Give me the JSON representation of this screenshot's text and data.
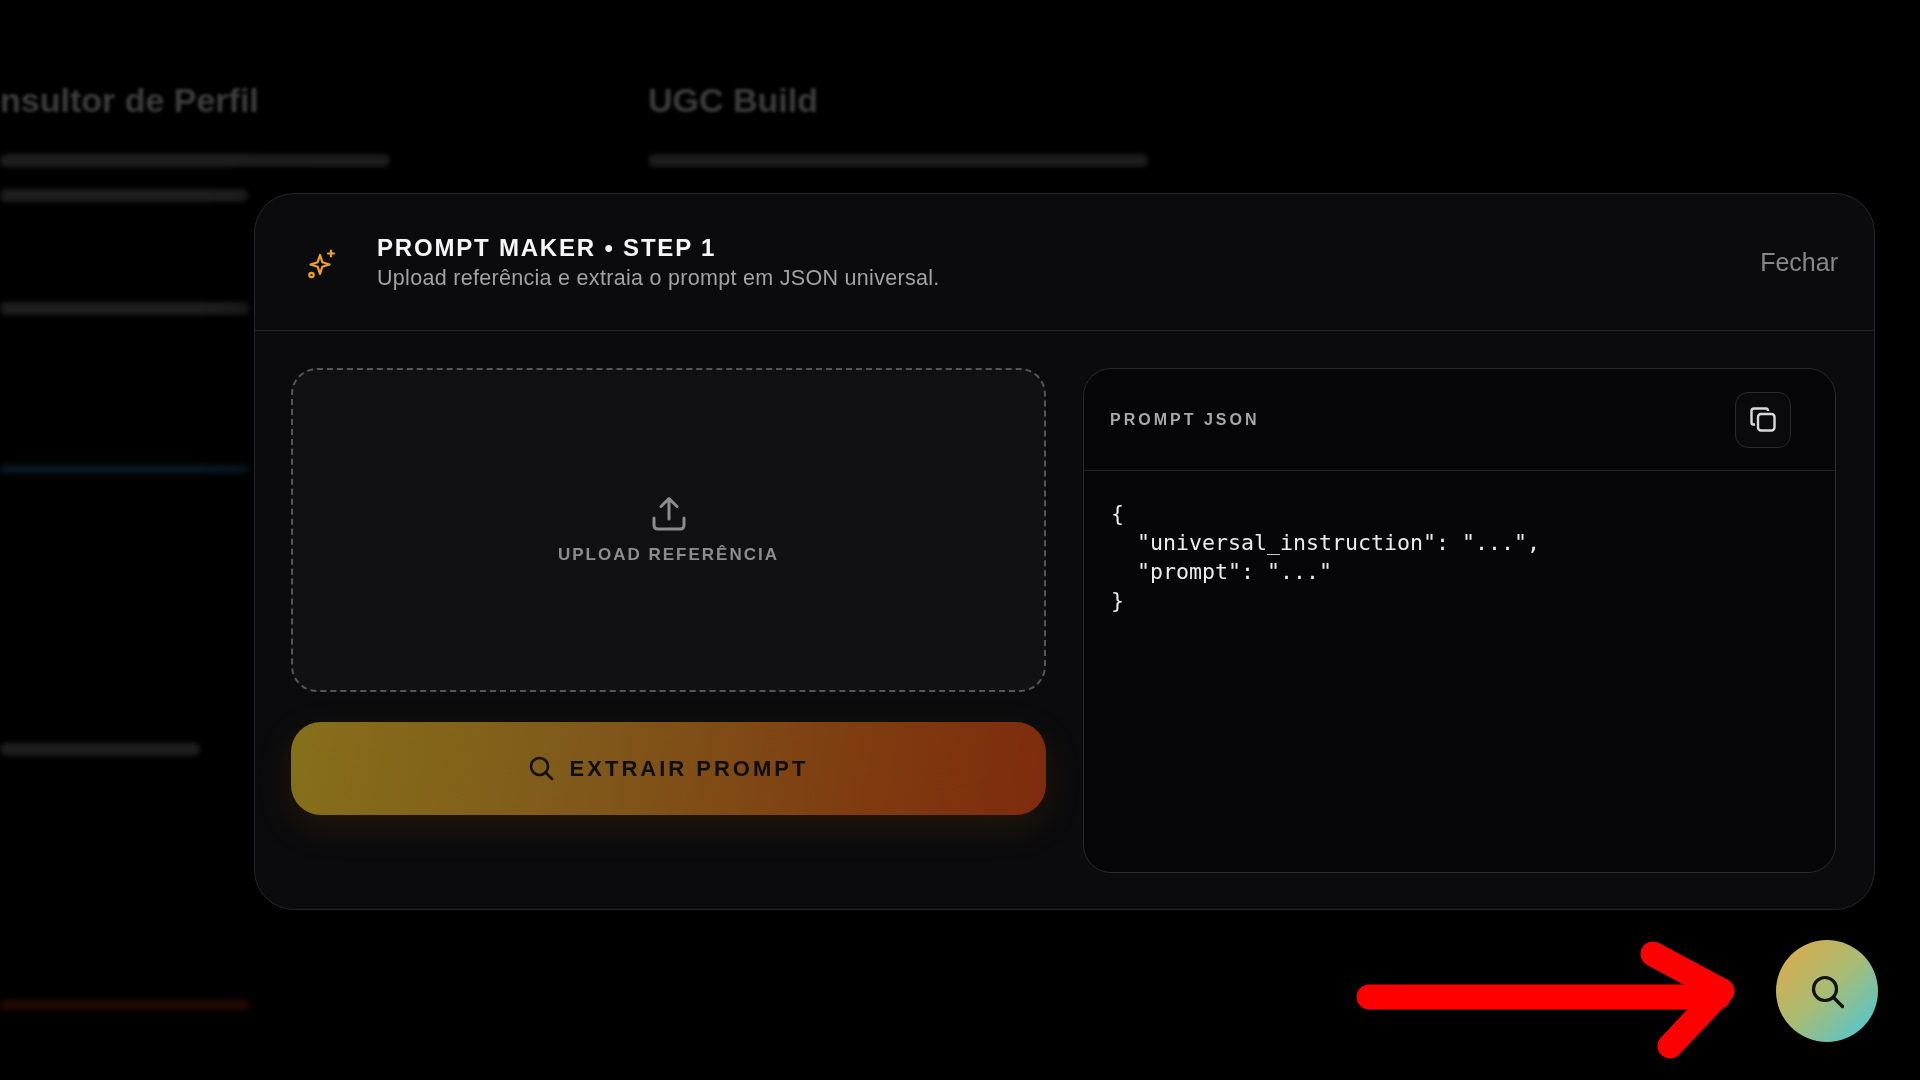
{
  "background": {
    "cards": [
      {
        "title": "nsultor de Perfil"
      },
      {
        "title": "UGC Build"
      }
    ]
  },
  "modal": {
    "title": "PROMPT MAKER • STEP 1",
    "subtitle": "Upload referência e extraia o prompt em JSON universal.",
    "close_label": "Fechar",
    "upload": {
      "label": "UPLOAD REFERÊNCIA"
    },
    "extract_button": "EXTRAIR PROMPT",
    "output": {
      "title": "PROMPT JSON",
      "code_lines": [
        "{",
        "  \"universal_instruction\": \"...\",",
        "  \"prompt\": \"...\"",
        "}"
      ]
    }
  }
}
